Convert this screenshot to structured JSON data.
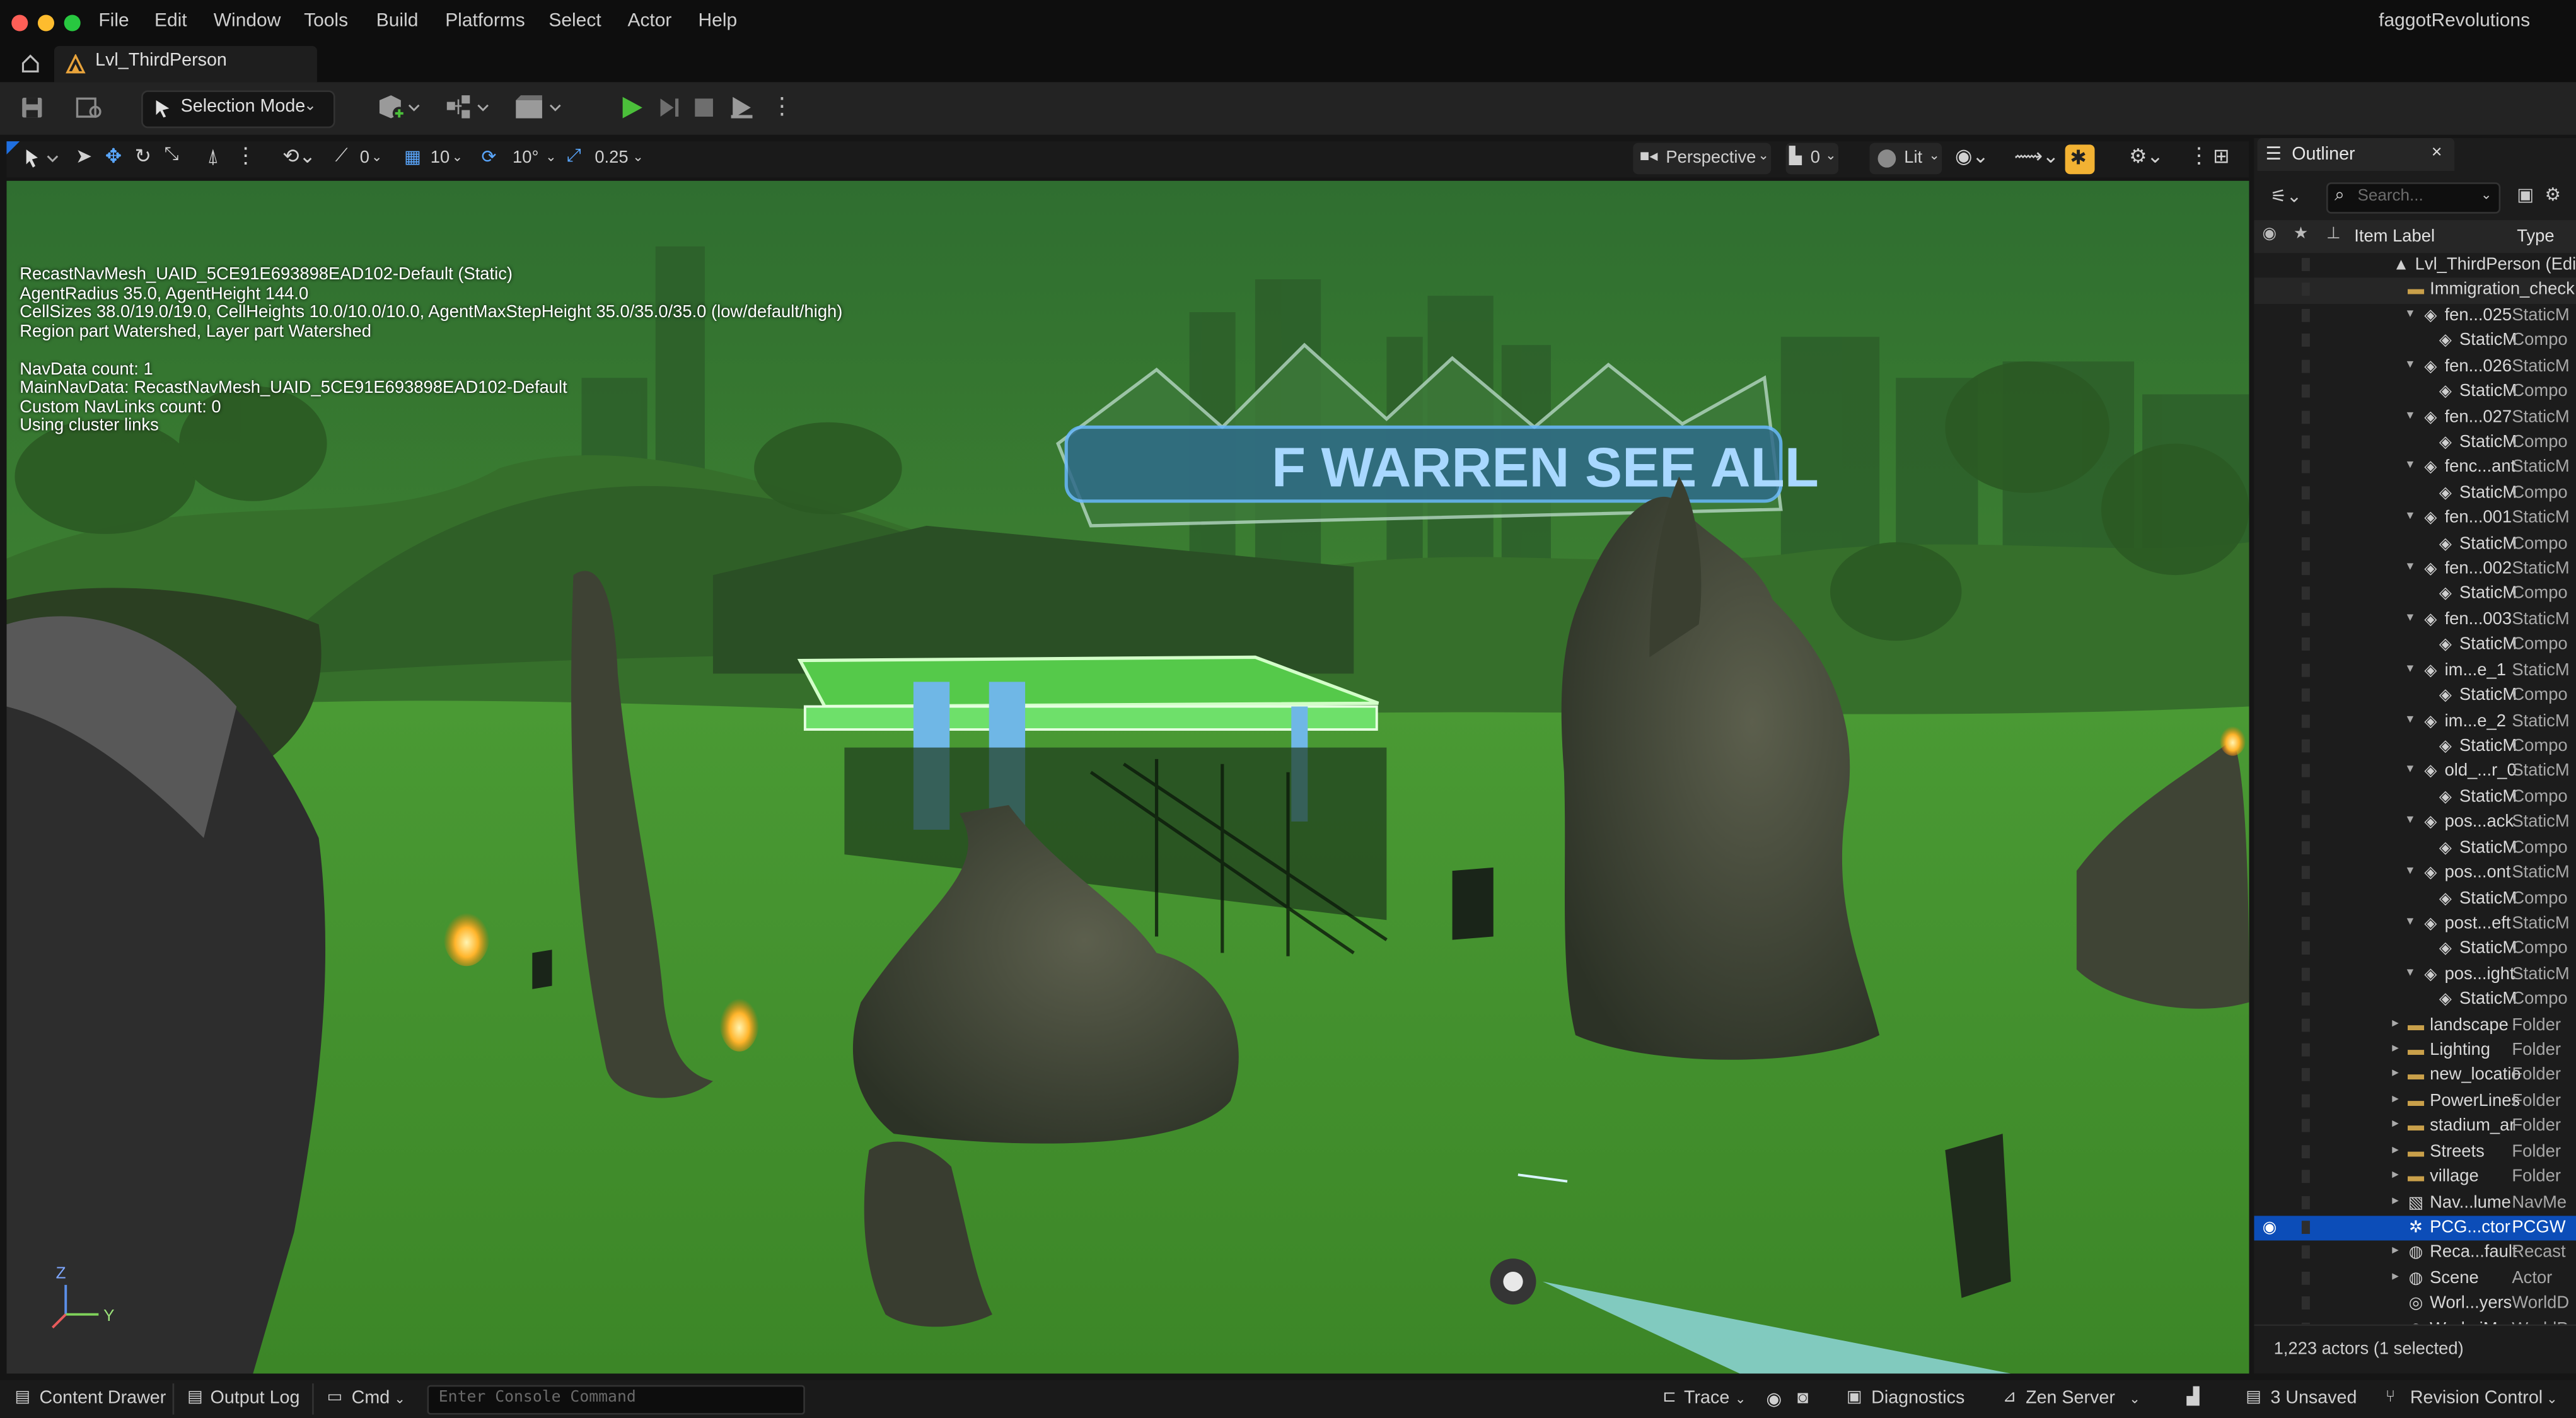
{
  "menu": {
    "file": "File",
    "edit": "Edit",
    "window": "Window",
    "tools": "Tools",
    "build": "Build",
    "platforms": "Platforms",
    "select": "Select",
    "actor": "Actor",
    "help": "Help"
  },
  "app_title": "faggotRevolutions",
  "tab": {
    "level_name": "Lvl_ThirdPerson"
  },
  "toolbar": {
    "selection_mode": "Selection Mode"
  },
  "viewport_toolbar": {
    "snap_rotation_value": "0",
    "grid_snap_value": "10",
    "rotation_snap_value": "10°",
    "scale_snap_value": "0.25",
    "view_mode": "Perspective",
    "camera_speed": "0",
    "lighting_mode": "Lit"
  },
  "viewport": {
    "stats_lines": [
      "RecastNavMesh_UAID_5CE91E693898EAD102-Default (Static)",
      "AgentRadius 35.0, AgentHeight 144.0",
      "CellSizes 38.0/19.0/19.0, CellHeights 10.0/10.0/10.0, AgentMaxStepHeight 35.0/35.0/35.0 (low/default/high)",
      "Region part Watershed, Layer part Watershed",
      "",
      "NavData count: 1",
      "MainNavData: RecastNavMesh_UAID_5CE91E693898EAD102-Default",
      "Custom NavLinks count: 0",
      "Using cluster links"
    ],
    "sign_text": "F WARREN SEE ALL",
    "gizmo_z": "Z",
    "gizmo_y": "Y"
  },
  "outliner": {
    "tab_label": "Outliner",
    "search_placeholder": "Search...",
    "col_label": "Item Label",
    "col_type": "Type",
    "rows": [
      {
        "label": "Lvl_ThirdPerson (Edit",
        "type": "",
        "indent": 4,
        "icon": "level",
        "arrow": ""
      },
      {
        "label": "Immigration_check",
        "type": "",
        "indent": 5,
        "icon": "folder",
        "arrow": "",
        "highlight": true
      },
      {
        "label": "fen...025",
        "type": "StaticM",
        "indent": 6,
        "icon": "mesh",
        "arrow": "▾"
      },
      {
        "label": "StaticM",
        "type": "Compo",
        "indent": 7,
        "icon": "mesh",
        "arrow": ""
      },
      {
        "label": "fen...026",
        "type": "StaticM",
        "indent": 6,
        "icon": "mesh",
        "arrow": "▾"
      },
      {
        "label": "StaticM",
        "type": "Compo",
        "indent": 7,
        "icon": "mesh",
        "arrow": ""
      },
      {
        "label": "fen...027",
        "type": "StaticM",
        "indent": 6,
        "icon": "mesh",
        "arrow": "▾"
      },
      {
        "label": "StaticM",
        "type": "Compo",
        "indent": 7,
        "icon": "mesh",
        "arrow": ""
      },
      {
        "label": "fenc...ant",
        "type": "StaticM",
        "indent": 6,
        "icon": "mesh",
        "arrow": "▾"
      },
      {
        "label": "StaticM",
        "type": "Compo",
        "indent": 7,
        "icon": "mesh",
        "arrow": ""
      },
      {
        "label": "fen...001",
        "type": "StaticM",
        "indent": 6,
        "icon": "mesh",
        "arrow": "▾"
      },
      {
        "label": "StaticM",
        "type": "Compo",
        "indent": 7,
        "icon": "mesh",
        "arrow": ""
      },
      {
        "label": "fen...002",
        "type": "StaticM",
        "indent": 6,
        "icon": "mesh",
        "arrow": "▾"
      },
      {
        "label": "StaticM",
        "type": "Compo",
        "indent": 7,
        "icon": "mesh",
        "arrow": ""
      },
      {
        "label": "fen...003",
        "type": "StaticM",
        "indent": 6,
        "icon": "mesh",
        "arrow": "▾"
      },
      {
        "label": "StaticM",
        "type": "Compo",
        "indent": 7,
        "icon": "mesh",
        "arrow": ""
      },
      {
        "label": "im...e_1",
        "type": "StaticM",
        "indent": 6,
        "icon": "mesh",
        "arrow": "▾"
      },
      {
        "label": "StaticM",
        "type": "Compo",
        "indent": 7,
        "icon": "mesh",
        "arrow": ""
      },
      {
        "label": "im...e_2",
        "type": "StaticM",
        "indent": 6,
        "icon": "mesh",
        "arrow": "▾"
      },
      {
        "label": "StaticM",
        "type": "Compo",
        "indent": 7,
        "icon": "mesh",
        "arrow": ""
      },
      {
        "label": "old_...r_0",
        "type": "StaticM",
        "indent": 6,
        "icon": "mesh",
        "arrow": "▾"
      },
      {
        "label": "StaticM",
        "type": "Compo",
        "indent": 7,
        "icon": "mesh",
        "arrow": ""
      },
      {
        "label": "pos...ack",
        "type": "StaticM",
        "indent": 6,
        "icon": "mesh",
        "arrow": "▾"
      },
      {
        "label": "StaticM",
        "type": "Compo",
        "indent": 7,
        "icon": "mesh",
        "arrow": ""
      },
      {
        "label": "pos...ont",
        "type": "StaticM",
        "indent": 6,
        "icon": "mesh",
        "arrow": "▾"
      },
      {
        "label": "StaticM",
        "type": "Compo",
        "indent": 7,
        "icon": "mesh",
        "arrow": ""
      },
      {
        "label": "post...eft",
        "type": "StaticM",
        "indent": 6,
        "icon": "mesh",
        "arrow": "▾"
      },
      {
        "label": "StaticM",
        "type": "Compo",
        "indent": 7,
        "icon": "mesh",
        "arrow": ""
      },
      {
        "label": "pos...ight",
        "type": "StaticM",
        "indent": 6,
        "icon": "mesh",
        "arrow": "▾"
      },
      {
        "label": "StaticM",
        "type": "Compo",
        "indent": 7,
        "icon": "mesh",
        "arrow": ""
      },
      {
        "label": "landscape",
        "type": "Folder",
        "indent": 5,
        "icon": "folder",
        "arrow": "▸"
      },
      {
        "label": "Lighting",
        "type": "Folder",
        "indent": 5,
        "icon": "folder",
        "arrow": "▸"
      },
      {
        "label": "new_locatio",
        "type": "Folder",
        "indent": 5,
        "icon": "folder",
        "arrow": "▸"
      },
      {
        "label": "PowerLines",
        "type": "Folder",
        "indent": 5,
        "icon": "folder",
        "arrow": "▸"
      },
      {
        "label": "stadium_ar",
        "type": "Folder",
        "indent": 5,
        "icon": "folder",
        "arrow": "▸"
      },
      {
        "label": "Streets",
        "type": "Folder",
        "indent": 5,
        "icon": "folder",
        "arrow": "▸"
      },
      {
        "label": "village",
        "type": "Folder",
        "indent": 5,
        "icon": "folder",
        "arrow": "▸"
      },
      {
        "label": "Nav...lume",
        "type": "NavMe",
        "indent": 5,
        "icon": "volume",
        "arrow": "▸"
      },
      {
        "label": "PCG...ctor",
        "type": "PCGW",
        "indent": 5,
        "icon": "pcg",
        "arrow": "",
        "selected": true
      },
      {
        "label": "Reca...fault",
        "type": "Recast",
        "indent": 5,
        "icon": "actor",
        "arrow": "▸"
      },
      {
        "label": "Scene",
        "type": "Actor",
        "indent": 5,
        "icon": "actor",
        "arrow": "▸"
      },
      {
        "label": "Worl...yers",
        "type": "WorldD",
        "indent": 5,
        "icon": "world",
        "arrow": ""
      },
      {
        "label": "Worl...iMap",
        "type": "WorldP",
        "indent": 5,
        "icon": "world",
        "arrow": ""
      }
    ],
    "footer": "1,223 actors (1 selected)"
  },
  "statusbar": {
    "content_drawer": "Content Drawer",
    "output_log": "Output Log",
    "cmd": "Cmd",
    "console_placeholder": "Enter Console Command",
    "trace": "Trace",
    "diagnostics": "Diagnostics",
    "zen_server": "Zen Server",
    "unsaved": "3 Unsaved",
    "revision_control": "Revision Control"
  },
  "colors": {
    "accent_blue": "#0c4db8",
    "play_green": "#4bbf3a",
    "viewport_green": "#3f8e2c",
    "folder": "#c9a04a"
  }
}
